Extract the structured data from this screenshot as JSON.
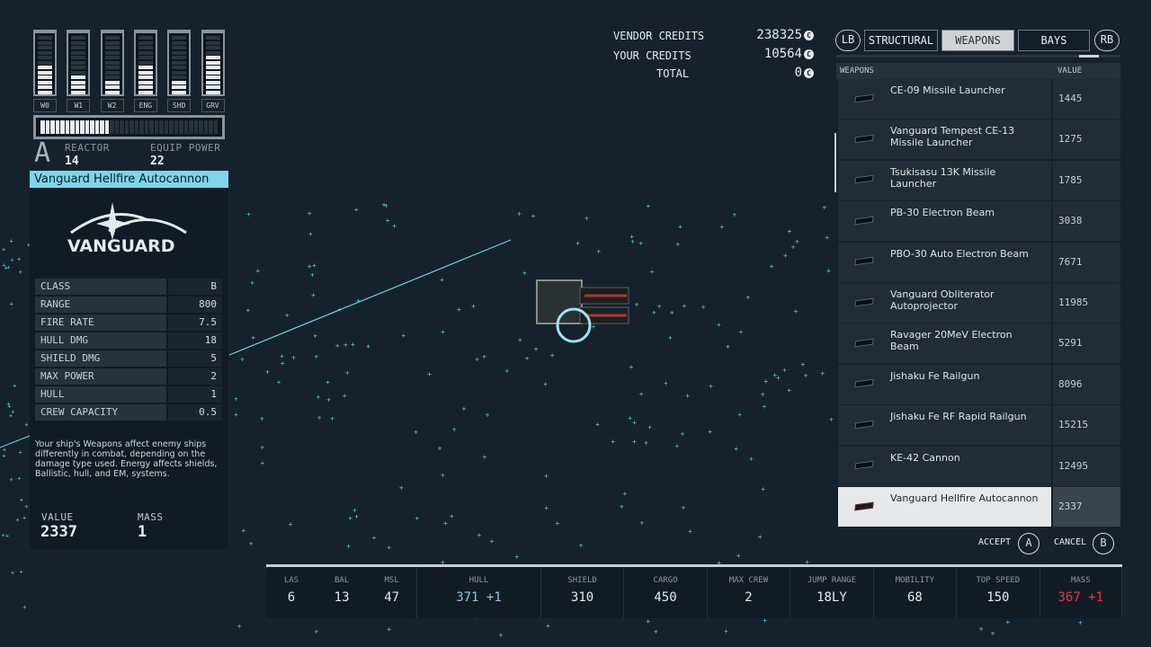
{
  "power": {
    "bars": [
      {
        "label": "W0",
        "level": 6,
        "max": 12
      },
      {
        "label": "W1",
        "level": 4,
        "max": 12
      },
      {
        "label": "W2",
        "level": 3,
        "max": 12
      },
      {
        "label": "ENG",
        "level": 6,
        "max": 12
      },
      {
        "label": "SHD",
        "level": 3,
        "max": 12
      },
      {
        "label": "GRV",
        "level": 8,
        "max": 12
      }
    ],
    "reactor_fill": 14,
    "reactor_max": 36,
    "class_letter": "A",
    "reactor_label": "REACTOR",
    "reactor_value": "14",
    "equip_label": "EQUIP POWER",
    "equip_value": "22"
  },
  "item": {
    "title": "Vanguard Hellfire Autocannon",
    "brand": "VANGUARD",
    "stats": [
      {
        "k": "CLASS",
        "v": "B"
      },
      {
        "k": "RANGE",
        "v": "800"
      },
      {
        "k": "FIRE RATE",
        "v": "7.5"
      },
      {
        "k": "HULL DMG",
        "v": "18"
      },
      {
        "k": "SHIELD DMG",
        "v": "5"
      },
      {
        "k": "MAX POWER",
        "v": "2"
      },
      {
        "k": "HULL",
        "v": "1"
      },
      {
        "k": "CREW CAPACITY",
        "v": "0.5"
      }
    ],
    "description": "Your ship's Weapons affect enemy ships differently in combat, depending on the damage type used. Energy affects shields, Ballistic, hull, and EM, systems.",
    "value_label": "VALUE",
    "value": "2337",
    "mass_label": "MASS",
    "mass": "1"
  },
  "credits": {
    "vendor_label": "VENDOR CREDITS",
    "vendor": "238325",
    "your_label": "YOUR CREDITS",
    "your": "10564",
    "total_label": "TOTAL",
    "total": "0"
  },
  "tabs": {
    "lb": "LB",
    "rb": "RB",
    "items": [
      "STRUCTURAL",
      "WEAPONS",
      "BAYS"
    ],
    "selected": 1
  },
  "list": {
    "col_name": "WEAPONS",
    "col_value": "VALUE",
    "items": [
      {
        "name": "CE-09 Missile Launcher",
        "value": "1445"
      },
      {
        "name": "Vanguard Tempest CE-13 Missile Launcher",
        "value": "1275"
      },
      {
        "name": "Tsukisasu 13K Missile Launcher",
        "value": "1785"
      },
      {
        "name": "PB-30 Electron Beam",
        "value": "3038"
      },
      {
        "name": "PBO-30 Auto Electron Beam",
        "value": "7671"
      },
      {
        "name": "Vanguard Obliterator Autoprojector",
        "value": "11985"
      },
      {
        "name": "Ravager 20MeV Electron Beam",
        "value": "5291"
      },
      {
        "name": "Jishaku Fe Railgun",
        "value": "8096"
      },
      {
        "name": "Jishaku Fe RF Rapid Railgun",
        "value": "15215"
      },
      {
        "name": "KE-42 Cannon",
        "value": "12495"
      },
      {
        "name": "Vanguard Hellfire Autocannon",
        "value": "2337"
      }
    ],
    "selected": 10
  },
  "actions": {
    "accept": "ACCEPT",
    "accept_key": "A",
    "cancel": "CANCEL",
    "cancel_key": "B"
  },
  "ship_stats": [
    {
      "l": "LAS",
      "v": "6"
    },
    {
      "l": "BAL",
      "v": "13"
    },
    {
      "l": "MSL",
      "v": "47"
    },
    {
      "l": "HULL",
      "v": "371 +1"
    },
    {
      "l": "SHIELD",
      "v": "310"
    },
    {
      "l": "CARGO",
      "v": "450"
    },
    {
      "l": "MAX CREW",
      "v": "2"
    },
    {
      "l": "JUMP RANGE",
      "v": "18LY"
    },
    {
      "l": "MOBILITY",
      "v": "68"
    },
    {
      "l": "TOP SPEED",
      "v": "150"
    },
    {
      "l": "MASS",
      "v": "367 +1"
    }
  ],
  "colors": {
    "accent": "#7dd6ea",
    "hull_delta": "#8fc7d8",
    "mass_delta": "#e8334f",
    "background": "#15222d"
  }
}
